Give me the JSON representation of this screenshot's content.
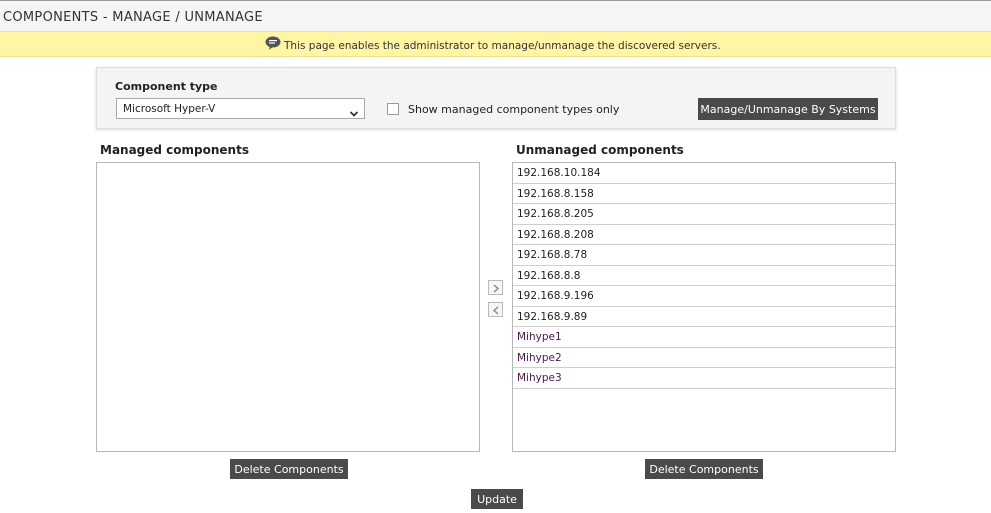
{
  "header": {
    "title": "COMPONENTS - MANAGE / UNMANAGE"
  },
  "banner": {
    "icon": "speech-bubble-icon",
    "text": "This page enables the administrator to manage/unmanage the discovered servers."
  },
  "filter": {
    "component_type_label": "Component type",
    "component_type_value": "Microsoft Hyper-V",
    "show_managed_only_label": "Show managed component types only",
    "show_managed_only_checked": false,
    "manage_by_systems_button": "Manage/Unmanage By Systems"
  },
  "managed": {
    "heading": "Managed components",
    "items": [],
    "delete_button": "Delete Components"
  },
  "unmanaged": {
    "heading": "Unmanaged components",
    "items": [
      "192.168.10.184",
      "192.168.8.158",
      "192.168.8.205",
      "192.168.8.208",
      "192.168.8.78",
      "192.168.8.8",
      "192.168.9.196",
      "192.168.9.89",
      "Mihype1",
      "Mihype2",
      "Mihype3"
    ],
    "delete_button": "Delete Components"
  },
  "transfer": {
    "move_right_icon": "chevron-right-icon",
    "move_left_icon": "chevron-left-icon"
  },
  "actions": {
    "update_button": "Update"
  },
  "colors": {
    "banner_bg": "#fef6a5",
    "button_bg": "#4a4a4a",
    "panel_bg": "#f4f4f4"
  }
}
